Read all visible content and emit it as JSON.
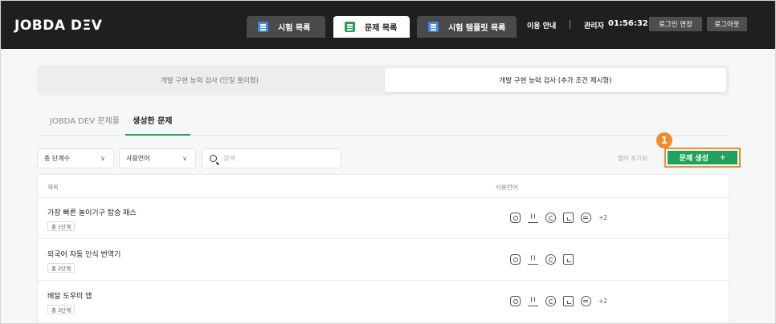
{
  "header": {
    "logo": "JOBDA DΞV",
    "tabs": [
      {
        "label": "시험 목록",
        "icon": "exam-list-icon"
      },
      {
        "label": "문제 목록",
        "icon": "problem-list-icon",
        "active": true
      },
      {
        "label": "시험 템플릿 목록",
        "icon": "template-list-icon"
      }
    ],
    "guide": "이용 안내",
    "admin": "관리자",
    "timer": "01:56:32",
    "extend_login": "로그인 연장",
    "logout": "로그아웃"
  },
  "exam_types": {
    "left": "개발 구현 능력 검사 (단일 풀이형)",
    "right": "개발 구현 능력 검사 (추가 조건 제시형)",
    "selected": "right"
  },
  "subtabs": {
    "pool": "JOBDA DEV 문제풀",
    "created": "생성한 문제",
    "active": "created"
  },
  "filters": {
    "steps": "총 단계수",
    "language": "사용언어",
    "search_placeholder": "검색",
    "reset": "필터 초기화",
    "create": "문제 생성",
    "create_icon": "+",
    "badge": "1"
  },
  "table": {
    "columns": {
      "title": "제목",
      "language": "사용언어"
    },
    "rows": [
      {
        "title": "가장 빠른 놀이기구 탑승 패스",
        "steps": "총 1단계",
        "langs": [
          "python",
          "java",
          "cpp",
          "javascript",
          "csharp"
        ],
        "more": "+2"
      },
      {
        "title": "외국어 자동 인식 번역기",
        "steps": "총 2단계",
        "langs": [
          "python",
          "java",
          "cpp",
          "javascript"
        ],
        "more": ""
      },
      {
        "title": "배달 도우미 앱",
        "steps": "총 3단계",
        "langs": [
          "python",
          "java",
          "cpp",
          "javascript",
          "csharp"
        ],
        "more": "+2"
      }
    ]
  },
  "colors": {
    "header_bg": "#1f1f1f",
    "accent_green": "#1ea25c",
    "highlight_orange": "#f08a2a",
    "tab_blue": "#3f86e8"
  }
}
